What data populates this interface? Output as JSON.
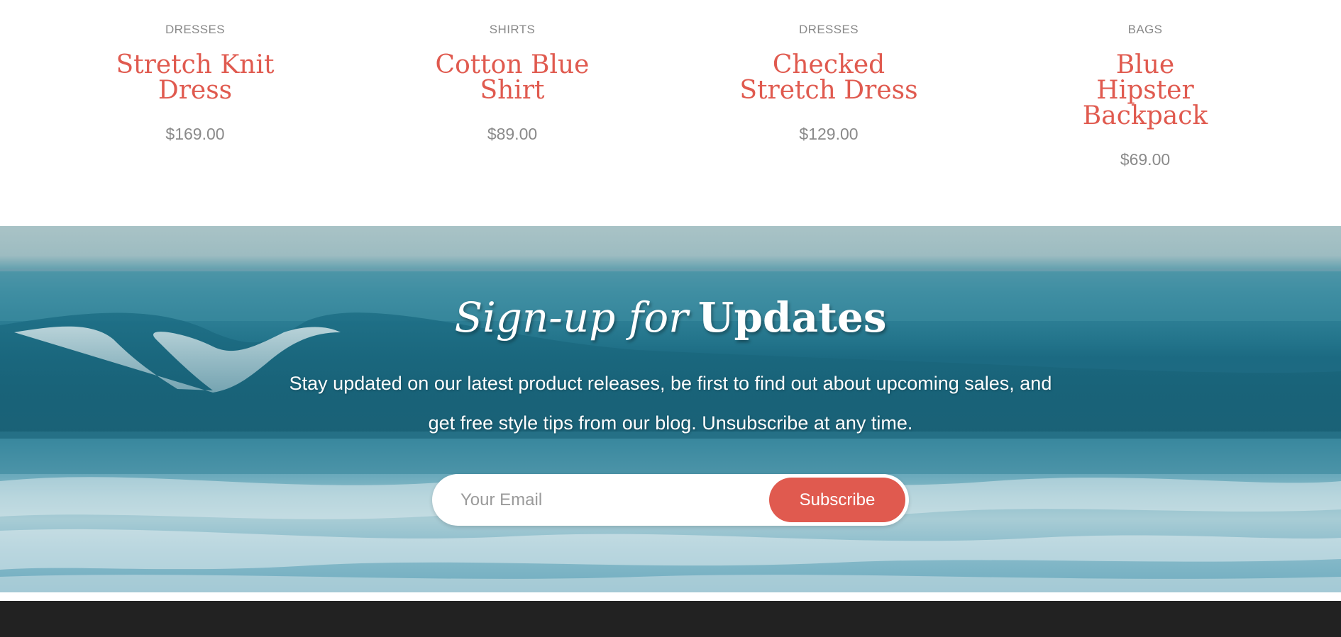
{
  "products": [
    {
      "category": "DRESSES",
      "name": "Stretch Knit Dress",
      "price": "$169.00"
    },
    {
      "category": "SHIRTS",
      "name": "Cotton Blue Shirt",
      "price": "$89.00"
    },
    {
      "category": "DRESSES",
      "name": "Checked Stretch Dress",
      "price": "$129.00"
    },
    {
      "category": "BAGS",
      "name": "Blue Hipster Backpack",
      "price": "$69.00"
    }
  ],
  "signup": {
    "heading_light": "Sign-up for",
    "heading_bold": "Updates",
    "description": "Stay updated on our latest product releases, be first to find out about upcoming sales, and get free style tips from our blog. Unsubscribe at any time.",
    "email_placeholder": "Your Email",
    "email_value": "",
    "subscribe_label": "Subscribe"
  },
  "colors": {
    "accent": "#e05a4f",
    "muted_text": "#8a8a8a",
    "footer_bg": "#222222"
  }
}
